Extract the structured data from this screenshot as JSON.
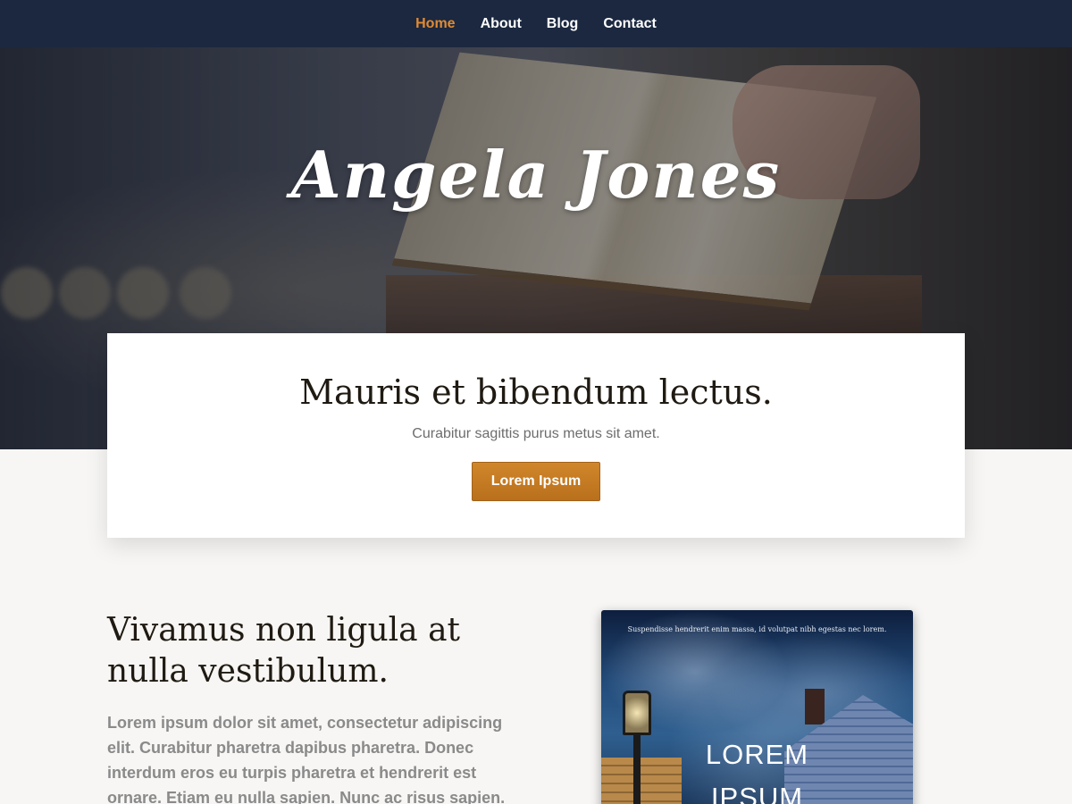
{
  "nav": {
    "items": [
      {
        "label": "Home",
        "active": true
      },
      {
        "label": "About",
        "active": false
      },
      {
        "label": "Blog",
        "active": false
      },
      {
        "label": "Contact",
        "active": false
      }
    ],
    "accent_color": "#e08a32",
    "background_color": "#1b2840"
  },
  "hero": {
    "title": "Angela Jones"
  },
  "callout": {
    "heading": "Mauris et bibendum lectus.",
    "subheading": "Curabitur sagittis purus metus sit amet.",
    "button_label": "Lorem Ipsum",
    "button_color": "#c77b24"
  },
  "section": {
    "title": "Vivamus non ligula at nulla vestibulum.",
    "body": "Lorem ipsum dolor sit amet, consectetur adipiscing elit. Curabitur pharetra dapibus pharetra. Donec interdum eros eu turpis pharetra et hendrerit est ornare. Etiam eu nulla sapien. Nunc ac risus sapien."
  },
  "book_cover": {
    "tagline": "Suspendisse hendrerit enim massa, id volutpat nibh egestas nec lorem.",
    "title_line1": "LOREM",
    "title_line2": "IPSUM"
  }
}
